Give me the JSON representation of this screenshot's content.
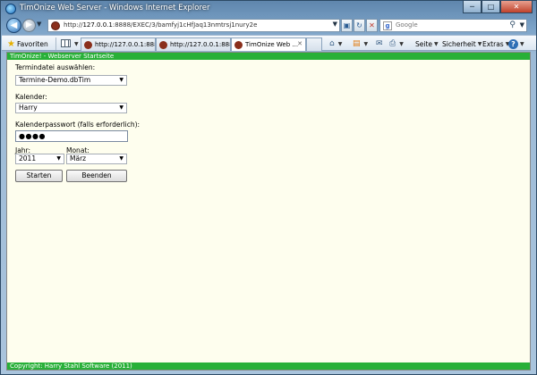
{
  "window": {
    "title": "TimOnize Web Server - Windows Internet Explorer",
    "min_symbol": "─",
    "max_symbol": "□",
    "close_symbol": "✕"
  },
  "nav": {
    "url_prefix": "http://",
    "url_host": "127.0.0.1",
    "url_rest": ":8888/EXEC/3/bamfyj1cHfJaq13nmtrsj1nury2e",
    "search_placeholder": "Google",
    "search_logo": "g"
  },
  "commandbar": {
    "favorites_label": "Favoriten",
    "tabs": [
      {
        "label": "http://127.0.0.1:888...",
        "active": false
      },
      {
        "label": "http://127.0.0.1:888...",
        "active": false
      },
      {
        "label": "TimOnize Web ...",
        "active": true
      }
    ],
    "tools": {
      "page_label": "Seite",
      "safety_label": "Sicherheit",
      "extras_label": "Extras"
    }
  },
  "page": {
    "header": "TimOnize! - Webserver Startseite",
    "footer": "Copyright: Harry Stahl Software (2011)",
    "file_label": "Termindatei auswählen:",
    "file_value": "Termine-Demo.dbTim",
    "calendar_label": "Kalender:",
    "calendar_value": "Harry",
    "password_label": "Kalenderpasswort (falls erforderlich):",
    "password_value": "●●●●",
    "year_label": "Jahr:",
    "year_value": "2011",
    "month_label": "Monat:",
    "month_value": "März",
    "start_button": "Starten",
    "end_button": "Beenden"
  },
  "colors": {
    "page_bg": "#fefeee",
    "header_green": "#28b038"
  }
}
